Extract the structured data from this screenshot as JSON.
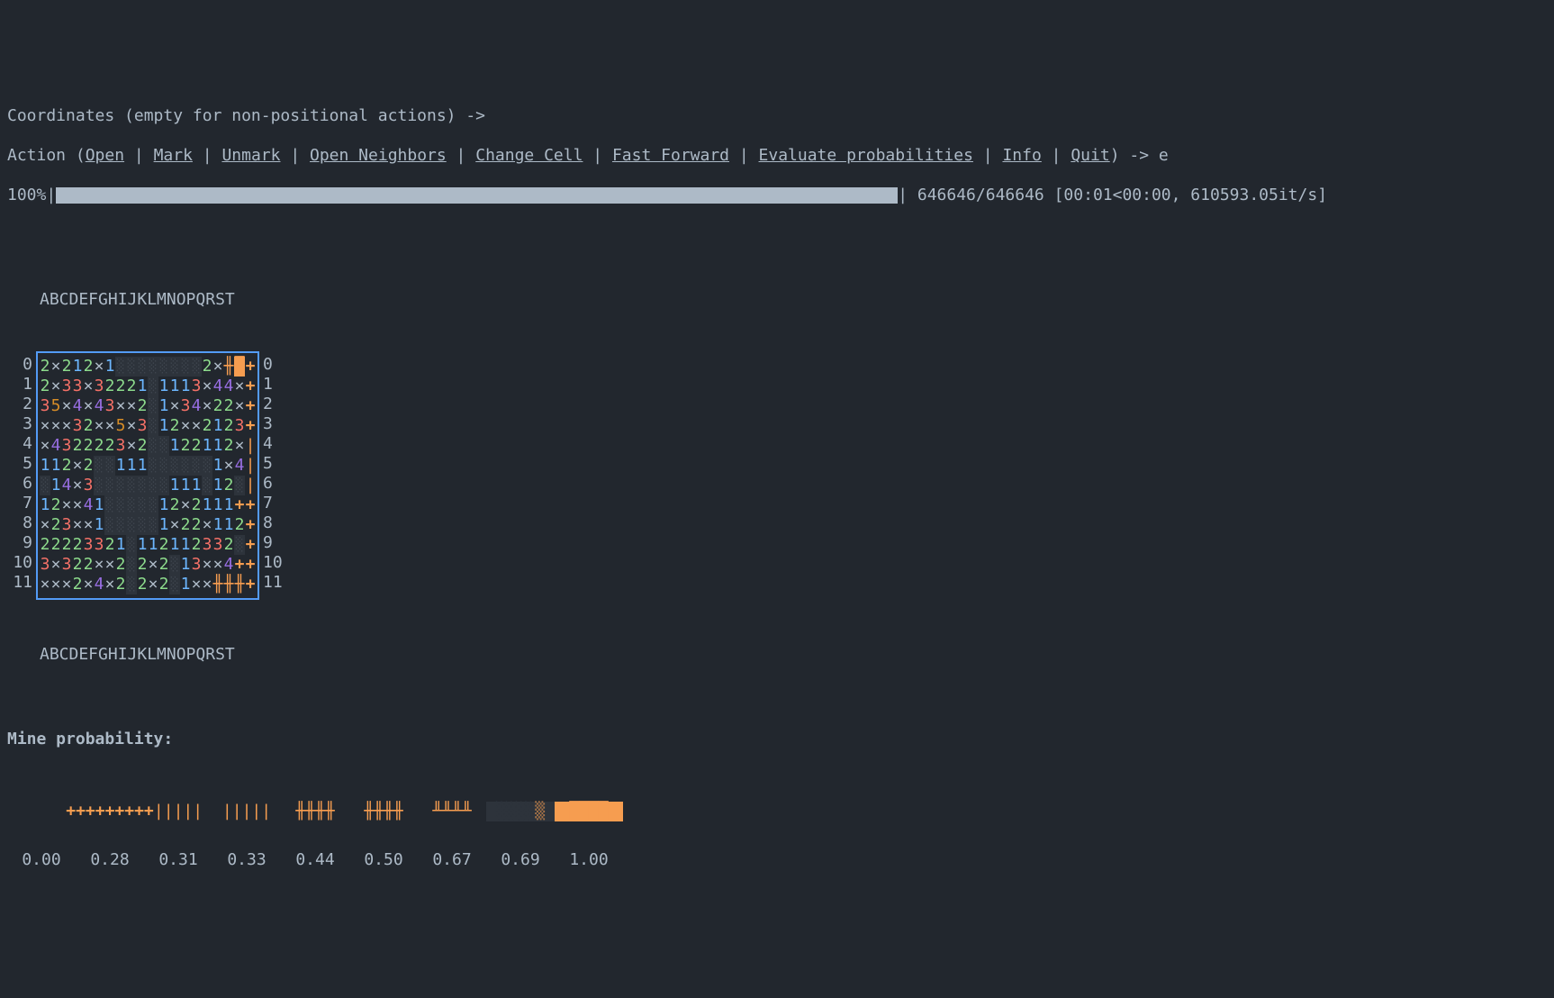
{
  "prompts": {
    "coord_prompt": "Coordinates (empty for non-positional actions) -> ",
    "action_prefix": "Action (",
    "actions": [
      "Open",
      "Mark",
      "Unmark",
      "Open Neighbors",
      "Change Cell",
      "Fast Forward",
      "Evaluate probabilities",
      "Info",
      "Quit"
    ],
    "action_suffix": ") -> ",
    "action_input": "e"
  },
  "progress": {
    "percent": "100%",
    "done": "646646",
    "total": "646646",
    "elapsed": "00:01",
    "remaining": "00:00",
    "rate": "610593.05it/s",
    "bar_filled_chars": 85
  },
  "board": {
    "cols": "ABCDEFGHIJKLMNOPQRST",
    "ncols": 20,
    "nrows": 12,
    "row_labels": [
      "0",
      "1",
      "2",
      "3",
      "4",
      "5",
      "6",
      "7",
      "8",
      "9",
      "10",
      "11"
    ],
    "cells": [
      [
        "2",
        "x",
        "2",
        "1",
        "2",
        "x",
        "1",
        ".",
        ".",
        ".",
        ".",
        ".",
        ".",
        ".",
        ".",
        "2",
        "x",
        "H",
        "S",
        "+"
      ],
      [
        "2",
        "x",
        "3",
        "3",
        "x",
        "3",
        "2",
        "2",
        "2",
        "1",
        ".",
        "1",
        "1",
        "1",
        "3",
        "x",
        "4",
        "4",
        "x",
        "+"
      ],
      [
        "3",
        "5",
        "x",
        "4",
        "x",
        "4",
        "3",
        "x",
        "x",
        "2",
        ".",
        "1",
        "x",
        "3",
        "4",
        "x",
        "2",
        "2",
        "x",
        "+"
      ],
      [
        "x",
        "x",
        "x",
        "3",
        "2",
        "x",
        "x",
        "5",
        "x",
        "3",
        ".",
        "1",
        "2",
        "x",
        "x",
        "2",
        "1",
        "2",
        "3",
        "+"
      ],
      [
        "x",
        "4",
        "3",
        "2",
        "2",
        "2",
        "2",
        "3",
        "x",
        "2",
        ".",
        ".",
        "1",
        "2",
        "2",
        "1",
        "1",
        "2",
        "x",
        "|"
      ],
      [
        "1",
        "1",
        "2",
        "x",
        "2",
        ".",
        ".",
        "1",
        "1",
        "1",
        ".",
        ".",
        ".",
        ".",
        ".",
        ".",
        "1",
        "x",
        "4",
        "|"
      ],
      [
        ".",
        "1",
        "4",
        "x",
        "3",
        ".",
        ".",
        ".",
        ".",
        ".",
        ".",
        ".",
        "1",
        "1",
        "1",
        ".",
        "1",
        "2",
        ".",
        "|"
      ],
      [
        "1",
        "2",
        "x",
        "x",
        "4",
        "1",
        ".",
        ".",
        ".",
        ".",
        ".",
        "1",
        "2",
        "x",
        "2",
        "1",
        "1",
        "1",
        "+",
        "+"
      ],
      [
        "x",
        "2",
        "3",
        "x",
        "x",
        "1",
        ".",
        ".",
        ".",
        ".",
        ".",
        "1",
        "x",
        "2",
        "2",
        "x",
        "1",
        "1",
        "2",
        "+"
      ],
      [
        "2",
        "2",
        "2",
        "2",
        "3",
        "3",
        "2",
        "1",
        ".",
        "1",
        "1",
        "2",
        "1",
        "1",
        "2",
        "3",
        "3",
        "2",
        ".",
        "+"
      ],
      [
        "3",
        "x",
        "3",
        "2",
        "2",
        "x",
        "x",
        "2",
        ".",
        "2",
        "x",
        "2",
        ".",
        "1",
        "3",
        "x",
        "x",
        "4",
        "+",
        "+"
      ],
      [
        "x",
        "x",
        "x",
        "2",
        "x",
        "4",
        "x",
        "2",
        ".",
        "2",
        "x",
        "2",
        ".",
        "1",
        "x",
        "x",
        "H",
        "H",
        "H",
        "+"
      ]
    ]
  },
  "prob_label": "Mine probability:",
  "legend": {
    "values": [
      "0.00",
      "0.28",
      "0.31",
      "0.33",
      "0.44",
      "0.50",
      "0.67",
      "0.69",
      "1.00"
    ],
    "glyph_class": [
      "",
      "p-plus",
      "p-vbar",
      "p-vbar",
      "p-hatch",
      "p-hatch",
      "p-cross",
      "p-box",
      "p-solid"
    ],
    "glyph_text": [
      "",
      "+++++++++",
      "|||||",
      "|||||",
      "╫╫╫╫",
      "╫╫╫╫",
      "╨╨╨╨",
      "░░░░",
      "████"
    ]
  }
}
